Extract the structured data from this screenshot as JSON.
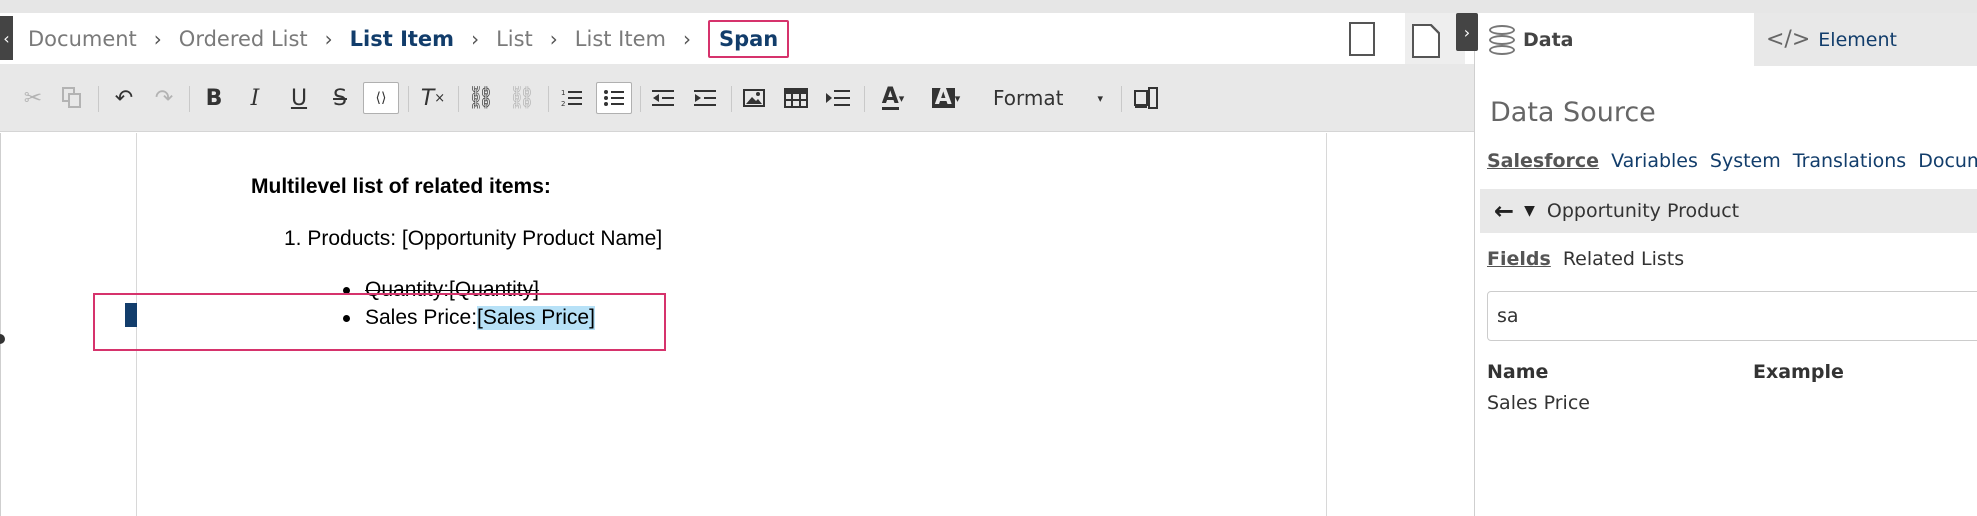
{
  "breadcrumb": {
    "items": [
      "Document",
      "Ordered List",
      "List Item",
      "List",
      "List Item"
    ],
    "current": "Span"
  },
  "toolbar": {
    "icons": [
      "cut-icon",
      "copy-icon",
      "undo-icon",
      "redo-icon",
      "bold-icon",
      "italic-icon",
      "underline-icon",
      "strikethrough-icon",
      "source-icon",
      "remove-format-icon",
      "link-icon",
      "unlink-icon",
      "numbered-list-icon",
      "bulleted-list-icon",
      "outdent-icon",
      "indent-icon",
      "image-icon",
      "table-icon",
      "block-icon",
      "text-color-icon",
      "background-color-icon",
      "page-layout-icon"
    ],
    "bold": "B",
    "italic": "I",
    "underline": "U",
    "strike": "S",
    "clear": "T",
    "text_color": "A",
    "bg_color": "A",
    "format_label": "Format"
  },
  "document": {
    "heading": "Multilevel list of related items:",
    "ordered_item": "1. Products: [Opportunity Product Name]",
    "sub_items": [
      {
        "label": "Quantity: ",
        "field": "[Quantity]"
      },
      {
        "label": "Sales Price: ",
        "field": "[Sales Price]"
      }
    ]
  },
  "panel": {
    "tabs": {
      "data": "Data",
      "element": "Element"
    },
    "data_source_title": "Data Source",
    "source_links": [
      "Salesforce",
      "Variables",
      "System",
      "Translations",
      "Documen"
    ],
    "object_name": "Opportunity Product",
    "sub_links": [
      "Fields",
      "Related Lists"
    ],
    "search_value": "sa",
    "result_headers": {
      "name": "Name",
      "example": "Example"
    },
    "result_rows": [
      {
        "name": "Sales Price"
      }
    ]
  },
  "colors": {
    "accent": "#123d6b",
    "selection_border": "#d6336c",
    "highlight": "#b7e1f7",
    "toolbar_bg": "#e8e8e8"
  }
}
